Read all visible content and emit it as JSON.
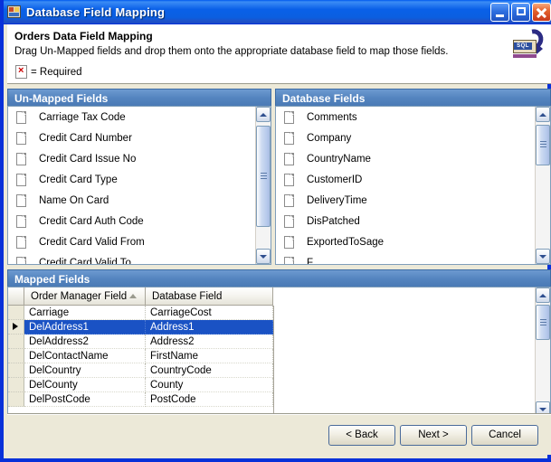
{
  "window": {
    "title": "Database Field Mapping",
    "icon": "application-window-icon",
    "controls": {
      "minimize": "Minimize",
      "maximize": "Maximize",
      "close": "Close"
    }
  },
  "header": {
    "title": "Orders Data Field Mapping",
    "description": "Drag Un-Mapped fields and drop them onto the appropriate database field to map those fields.",
    "required_legend": "= Required",
    "required_icon": "required-field-icon",
    "logo": "sql-database-logo",
    "logo_text": "SQL"
  },
  "unmapped": {
    "section_title": "Un-Mapped Fields",
    "items": [
      "Carriage Tax Code",
      "Credit Card Number",
      "Credit Card Issue No",
      "Credit Card Type",
      "Name On Card",
      "Credit Card Auth Code",
      "Credit Card Valid From",
      "Credit Card Valid To"
    ],
    "scrollbar": {
      "thumb_top_pct": 3,
      "thumb_height_pct": 80
    }
  },
  "database": {
    "section_title": "Database Fields",
    "items": [
      "Comments",
      "Company",
      "CountryName",
      "CustomerID",
      "DeliveryTime",
      "DisPatched",
      "ExportedToSage",
      "F"
    ],
    "scrollbar": {
      "thumb_top_pct": 2,
      "thumb_height_pct": 32
    }
  },
  "mapped": {
    "section_title": "Mapped Fields",
    "columns": [
      {
        "label": "Order Manager Field",
        "sort": "ascending"
      },
      {
        "label": "Database Field",
        "sort": "none"
      }
    ],
    "rows": [
      {
        "order_manager_field": "Carriage",
        "database_field": "CarriageCost",
        "selected": false
      },
      {
        "order_manager_field": "DelAddress1",
        "database_field": "Address1",
        "selected": true
      },
      {
        "order_manager_field": "DelAddress2",
        "database_field": "Address2",
        "selected": false
      },
      {
        "order_manager_field": "DelContactName",
        "database_field": "FirstName",
        "selected": false
      },
      {
        "order_manager_field": "DelCountry",
        "database_field": "CountryCode",
        "selected": false
      },
      {
        "order_manager_field": "DelCounty",
        "database_field": "County",
        "selected": false
      },
      {
        "order_manager_field": "DelPostCode",
        "database_field": "PostCode",
        "selected": false
      }
    ],
    "scrollbar": {
      "thumb_top_pct": 2,
      "thumb_height_pct": 36
    }
  },
  "buttons": {
    "back": "< Back",
    "next": "Next >",
    "cancel": "Cancel"
  },
  "colors": {
    "title_bar_blue": "#0a60e8",
    "window_border_blue": "#0831d9",
    "section_header_blue": "#4a7ab5",
    "dialog_background": "#ece9d8",
    "selection_blue": "#1a52c4",
    "list_background": "#ffffff"
  }
}
